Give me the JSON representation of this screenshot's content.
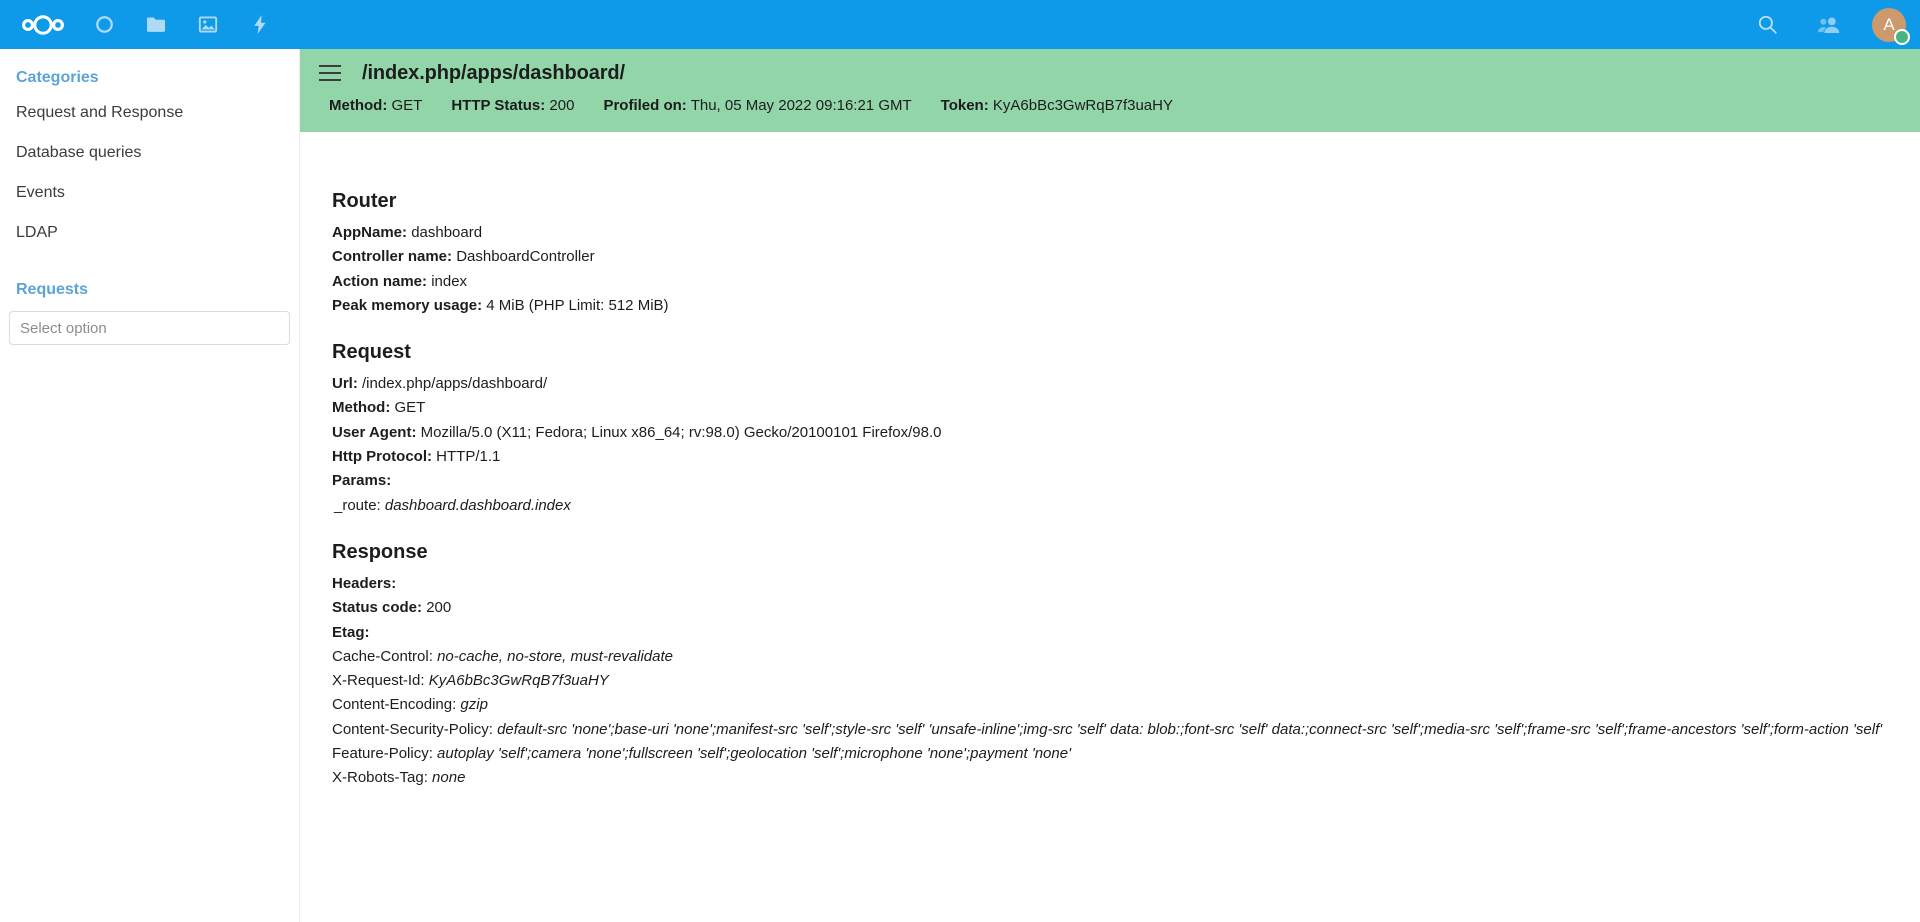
{
  "topbar": {
    "logo_name": "nextcloud-logo",
    "accent_color": "#0e9ae8",
    "apps": [
      {
        "name": "dashboard-icon",
        "label": "Dashboard"
      },
      {
        "name": "files-icon",
        "label": "Files"
      },
      {
        "name": "photos-icon",
        "label": "Photos"
      },
      {
        "name": "activity-icon",
        "label": "Activity"
      }
    ],
    "search_icon": "search-icon",
    "contacts_icon": "contacts-icon",
    "avatar_initial": "A",
    "avatar_color": "#cc9a6c",
    "status_color": "#49b382"
  },
  "sidebar": {
    "categories_header": "Categories",
    "categories": [
      {
        "label": "Request and Response"
      },
      {
        "label": "Database queries"
      },
      {
        "label": "Events"
      },
      {
        "label": "LDAP"
      }
    ],
    "requests_header": "Requests",
    "select_placeholder": "Select option",
    "header_color": "#5ba5d6"
  },
  "banner": {
    "background": "#92d5a8",
    "menu_icon": "hamburger-menu-icon",
    "title": "/index.php/apps/dashboard/",
    "meta": [
      {
        "label": "Method:",
        "value": "GET"
      },
      {
        "label": "HTTP Status:",
        "value": "200"
      },
      {
        "label": "Profiled on:",
        "value": "Thu, 05 May 2022 09:16:21 GMT"
      },
      {
        "label": "Token:",
        "value": "KyA6bBc3GwRqB7f3uaHY"
      }
    ]
  },
  "router": {
    "title": "Router",
    "appname_label": "AppName:",
    "appname_value": "dashboard",
    "controller_label": "Controller name:",
    "controller_value": "DashboardController",
    "action_label": "Action name:",
    "action_value": "index",
    "memory_label": "Peak memory usage:",
    "memory_value": "4 MiB (PHP Limit: 512 MiB)"
  },
  "request": {
    "title": "Request",
    "url_label": "Url:",
    "url_value": "/index.php/apps/dashboard/",
    "method_label": "Method:",
    "method_value": "GET",
    "ua_label": "User Agent:",
    "ua_value": "Mozilla/5.0 (X11; Fedora; Linux x86_64; rv:98.0) Gecko/20100101 Firefox/98.0",
    "protocol_label": "Http Protocol:",
    "protocol_value": "HTTP/1.1",
    "params_label": "Params:",
    "param_route_key": "_route:",
    "param_route_value": "dashboard.dashboard.index"
  },
  "response": {
    "title": "Response",
    "headers_label": "Headers:",
    "status_label": "Status code:",
    "status_value": "200",
    "etag_label": "Etag:",
    "cache_key": "Cache-Control:",
    "cache_value": "no-cache, no-store, must-revalidate",
    "reqid_key": "X-Request-Id:",
    "reqid_value": "KyA6bBc3GwRqB7f3uaHY",
    "encoding_key": "Content-Encoding:",
    "encoding_value": "gzip",
    "csp_key": "Content-Security-Policy:",
    "csp_value": "default-src 'none';base-uri 'none';manifest-src 'self';style-src 'self' 'unsafe-inline';img-src 'self' data: blob:;font-src 'self' data:;connect-src 'self';media-src 'self';frame-src 'self';frame-ancestors 'self';form-action 'self'",
    "feature_key": "Feature-Policy:",
    "feature_value": "autoplay 'self';camera 'none';fullscreen 'self';geolocation 'self';microphone 'none';payment 'none'",
    "robots_key": "X-Robots-Tag:",
    "robots_value": "none"
  }
}
